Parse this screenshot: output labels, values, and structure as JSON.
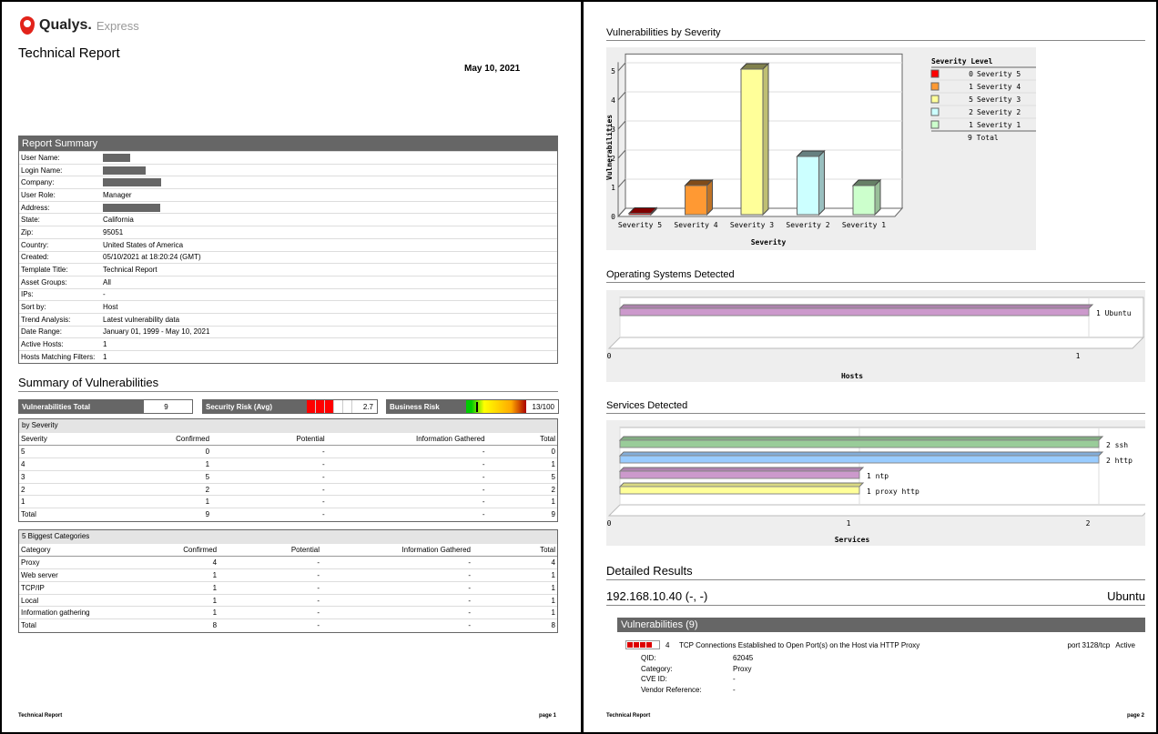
{
  "page1": {
    "logo": {
      "brand": "Qualys.",
      "product": "Express"
    },
    "title": "Technical Report",
    "date": "May 10, 2021",
    "summary": {
      "header": "Report Summary",
      "rows": [
        {
          "k": "User Name:",
          "v": "",
          "redacted": true
        },
        {
          "k": "Login Name:",
          "v": "",
          "redacted": true
        },
        {
          "k": "Company:",
          "v": "",
          "redacted": true
        },
        {
          "k": "User Role:",
          "v": "Manager"
        },
        {
          "k": "Address:",
          "v": "",
          "redacted": true
        },
        {
          "k": "State:",
          "v": "California"
        },
        {
          "k": "Zip:",
          "v": "95051"
        },
        {
          "k": "Country:",
          "v": "United States of America"
        },
        {
          "k": "Created:",
          "v": "05/10/2021 at 18:20:24 (GMT)"
        },
        {
          "k": "Template Title:",
          "v": "Technical Report"
        },
        {
          "k": "Asset Groups:",
          "v": "All"
        },
        {
          "k": "IPs:",
          "v": "-"
        },
        {
          "k": "Sort by:",
          "v": "Host"
        },
        {
          "k": "Trend Analysis:",
          "v": "Latest vulnerability data"
        },
        {
          "k": "Date Range:",
          "v": "January 01, 1999 - May 10, 2021"
        },
        {
          "k": "Active Hosts:",
          "v": "1"
        },
        {
          "k": "Hosts Matching Filters:",
          "v": "1"
        }
      ]
    },
    "vuln_summary_title": "Summary of Vulnerabilities",
    "stats": {
      "vuln_total_label": "Vulnerabilities Total",
      "vuln_total": "9",
      "security_risk_label": "Security Risk (Avg)",
      "security_risk": "2.7",
      "security_risk_level": 3,
      "business_risk_label": "Business Risk",
      "business_risk": "13/100",
      "business_risk_fraction": 0.13
    },
    "by_severity": {
      "title": "by Severity",
      "headers": [
        "Severity",
        "Confirmed",
        "Potential",
        "Information Gathered",
        "Total"
      ],
      "rows": [
        [
          "5",
          "0",
          "-",
          "-",
          "0"
        ],
        [
          "4",
          "1",
          "-",
          "-",
          "1"
        ],
        [
          "3",
          "5",
          "-",
          "-",
          "5"
        ],
        [
          "2",
          "2",
          "-",
          "-",
          "2"
        ],
        [
          "1",
          "1",
          "-",
          "-",
          "1"
        ],
        [
          "Total",
          "9",
          "-",
          "-",
          "9"
        ]
      ]
    },
    "categories": {
      "title": "5 Biggest Categories",
      "headers": [
        "Category",
        "Confirmed",
        "Potential",
        "Information Gathered",
        "Total"
      ],
      "rows": [
        [
          "Proxy",
          "4",
          "-",
          "-",
          "4"
        ],
        [
          "Web server",
          "1",
          "-",
          "-",
          "1"
        ],
        [
          "TCP/IP",
          "1",
          "-",
          "-",
          "1"
        ],
        [
          "Local",
          "1",
          "-",
          "-",
          "1"
        ],
        [
          "Information gathering",
          "1",
          "-",
          "-",
          "1"
        ],
        [
          "Total",
          "8",
          "-",
          "-",
          "8"
        ]
      ]
    },
    "footer": {
      "left": "Technical Report",
      "right": "page 1"
    }
  },
  "page2": {
    "sev_title": "Vulnerabilities by Severity",
    "os_title": "Operating Systems Detected",
    "svc_title": "Services Detected",
    "detailed_title": "Detailed Results",
    "host": {
      "ip": "192.168.10.40 (-, -)",
      "os": "Ubuntu"
    },
    "vulns_header": "Vulnerabilities (9)",
    "vuln": {
      "severity": "4",
      "title": "TCP Connections Established to Open Port(s) on the Host via HTTP Proxy",
      "port": "port 3128/tcp",
      "status": "Active",
      "details": [
        {
          "k": "QID:",
          "v": "62045"
        },
        {
          "k": "Category:",
          "v": "Proxy"
        },
        {
          "k": "CVE ID:",
          "v": "-"
        },
        {
          "k": "Vendor Reference:",
          "v": "-"
        }
      ]
    },
    "footer": {
      "left": "Technical Report",
      "right": "page 2"
    }
  },
  "chart_data": [
    {
      "type": "bar",
      "title": "Vulnerabilities by Severity",
      "xlabel": "Severity",
      "ylabel": "Vulnerabilities",
      "ylim": [
        0,
        5
      ],
      "yticks": [
        "0",
        "1",
        "2",
        "3",
        "4",
        "5"
      ],
      "categories": [
        "Severity 5",
        "Severity 4",
        "Severity 3",
        "Severity 2",
        "Severity 1"
      ],
      "values": [
        0,
        1,
        5,
        2,
        1
      ],
      "colors": [
        "#ff0000",
        "#ff9933",
        "#ffff99",
        "#ccffff",
        "#ccffcc"
      ],
      "legend": {
        "title": "Severity Level",
        "placement": "right",
        "total_label": "9 Total"
      }
    },
    {
      "type": "bar",
      "orientation": "horizontal",
      "title": "Operating Systems Detected",
      "xlabel": "Hosts",
      "xlim": [
        0,
        1
      ],
      "xticks": [
        "0",
        "1"
      ],
      "categories": [
        "Ubuntu"
      ],
      "values": [
        1
      ],
      "labels": [
        "1 Ubuntu"
      ],
      "colors": [
        "#cc99cc"
      ]
    },
    {
      "type": "bar",
      "orientation": "horizontal",
      "title": "Services Detected",
      "xlabel": "Services",
      "xlim": [
        0,
        2
      ],
      "xticks": [
        "0",
        "1",
        "2"
      ],
      "categories": [
        "ssh",
        "http",
        "ntp",
        "proxy http"
      ],
      "values": [
        2,
        2,
        1,
        1
      ],
      "labels": [
        "2 ssh",
        "2 http",
        "1 ntp",
        "1 proxy http"
      ],
      "colors": [
        "#99cc99",
        "#99ccff",
        "#cc99cc",
        "#ffff99"
      ]
    }
  ]
}
